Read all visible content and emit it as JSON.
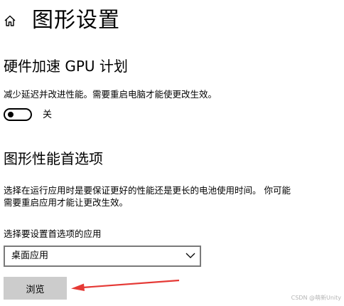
{
  "header": {
    "title": "图形设置",
    "home_icon": "home-icon"
  },
  "gpu_scheduling": {
    "heading": "硬件加速 GPU 计划",
    "description": "减少延迟并改进性能。需要重启电脑才能使更改生效。",
    "toggle_state_label": "关",
    "toggle_on": false
  },
  "graphics_preference": {
    "heading": "图形性能首选项",
    "description_line1": "选择在运行应用时是要保证更好的性能还是更长的电池使用时间。 你可能",
    "description_line2": "需要重启应用才能让更改生效。",
    "select_label": "选择要设置首选项的应用",
    "select_value": "桌面应用",
    "browse_label": "浏览"
  },
  "annotation": {
    "arrow_color": "#e53935"
  },
  "watermark": "CSDN @萌新Unity"
}
